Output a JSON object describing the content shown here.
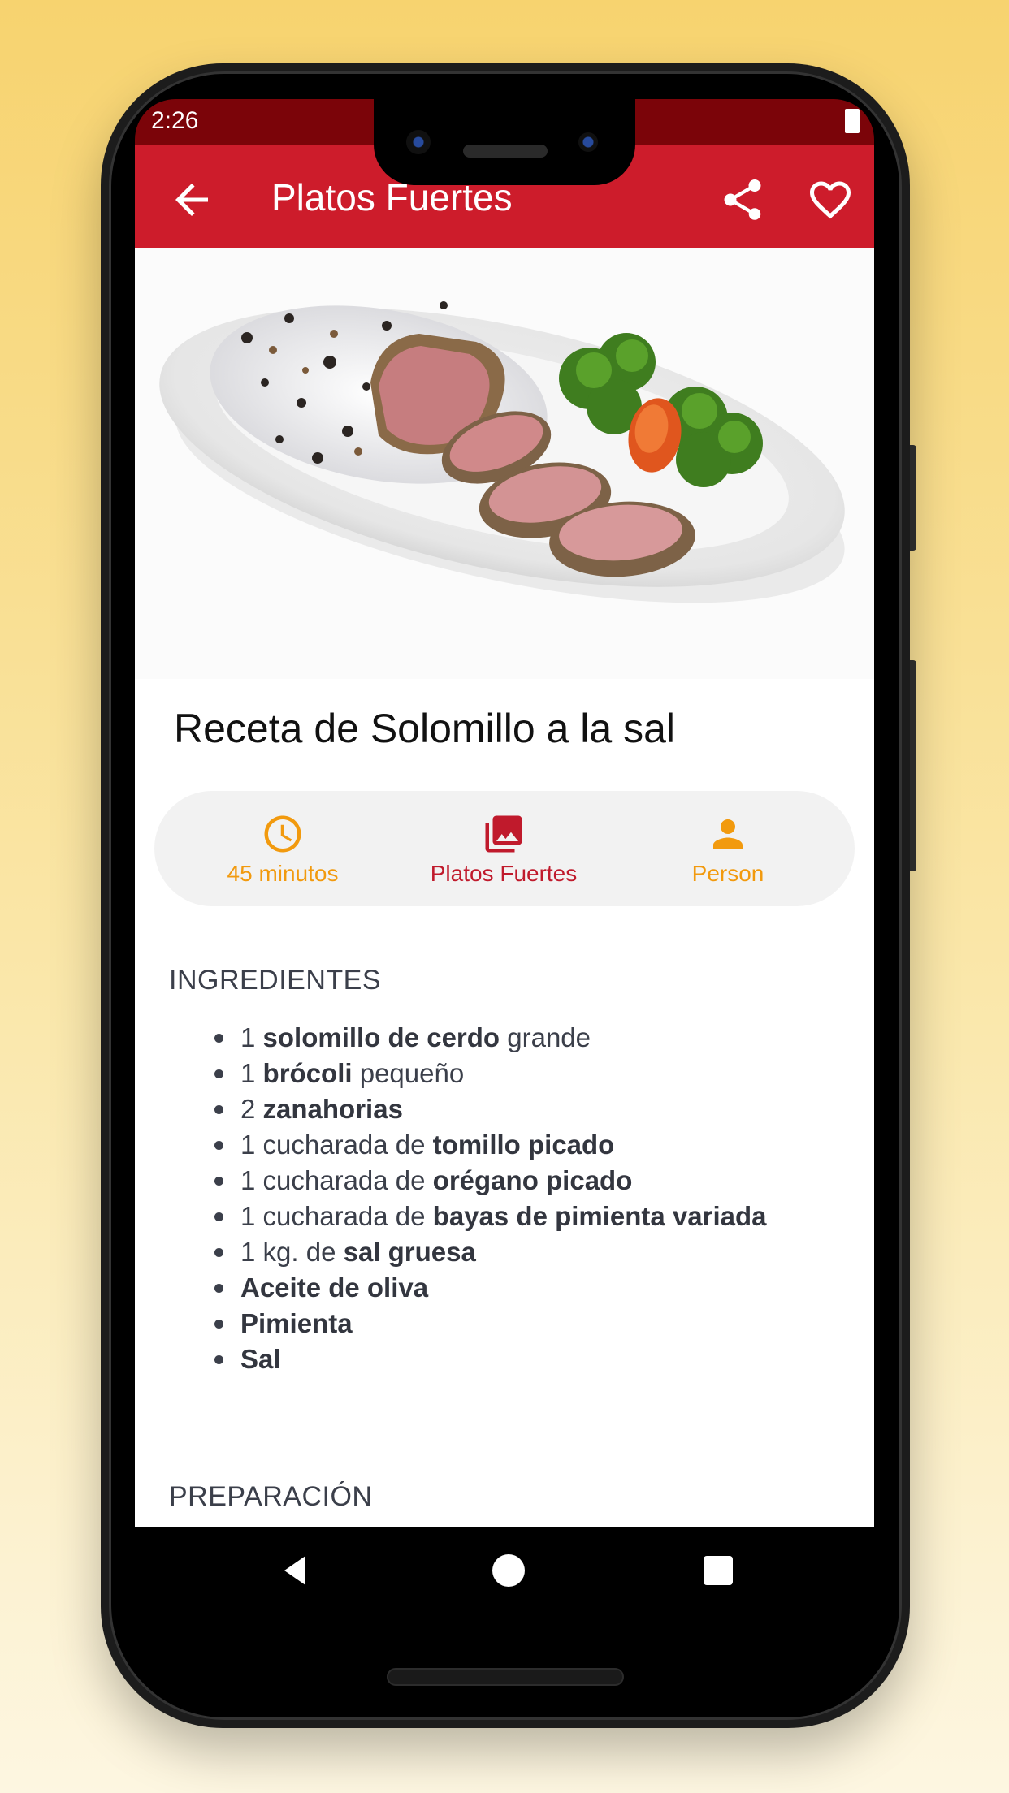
{
  "status": {
    "time": "2:26"
  },
  "appbar": {
    "title": "Platos Fuertes"
  },
  "recipe": {
    "title": "Receta de Solomillo a la sal"
  },
  "info": {
    "time": {
      "label": "45 minutos",
      "icon": "clock-icon",
      "color": "#f29a0e"
    },
    "category": {
      "label": "Platos Fuertes",
      "icon": "photo-library-icon",
      "color": "#c01a2c"
    },
    "person": {
      "label": "Person",
      "icon": "person-icon",
      "color": "#f29a0e"
    }
  },
  "sections": {
    "ingredients": "INGREDIENTES",
    "preparation": "PREPARACIÓN"
  },
  "ingredients": [
    {
      "pre": "1 ",
      "bold": "solomillo de cerdo",
      "post": " grande"
    },
    {
      "pre": "1 ",
      "bold": "brócoli",
      "post": " pequeño"
    },
    {
      "pre": "2 ",
      "bold": "zanahorias",
      "post": ""
    },
    {
      "pre": "1 cucharada de ",
      "bold": "tomillo picado",
      "post": ""
    },
    {
      "pre": "1 cucharada de ",
      "bold": "orégano picado",
      "post": ""
    },
    {
      "pre": "1 cucharada de ",
      "bold": "bayas de pimienta variada",
      "post": ""
    },
    {
      "pre": "1 kg. de ",
      "bold": "sal gruesa",
      "post": ""
    },
    {
      "pre": "",
      "bold": "Aceite de oliva",
      "post": ""
    },
    {
      "pre": "",
      "bold": "Pimienta",
      "post": ""
    },
    {
      "pre": "",
      "bold": "Sal",
      "post": ""
    }
  ],
  "colors": {
    "appbar": "#cd1c2b",
    "statusbar": "#7b0409",
    "accent": "#f29a0e"
  }
}
